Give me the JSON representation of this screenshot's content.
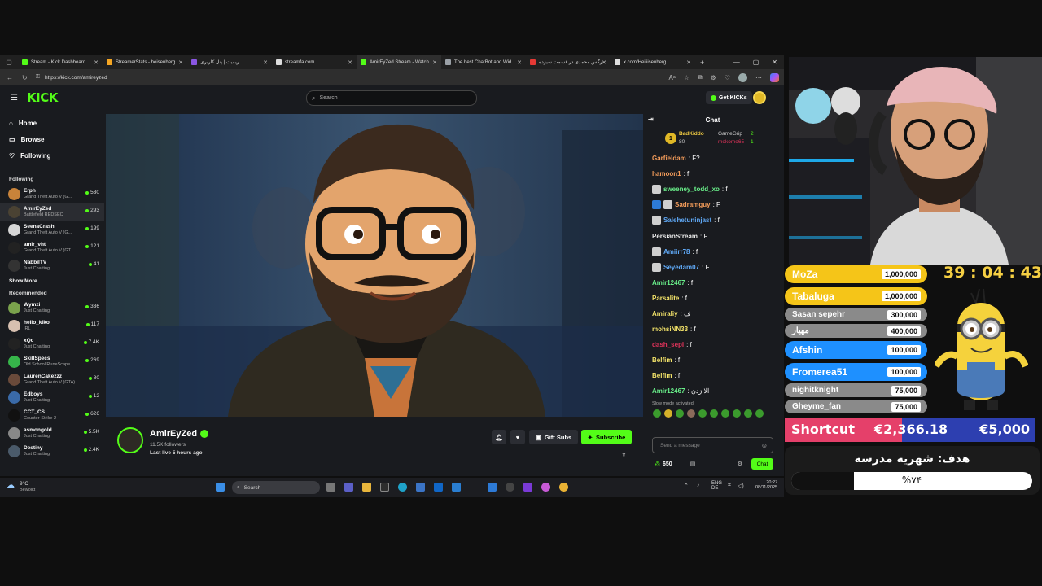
{
  "browser": {
    "tabs": [
      {
        "title": "Stream - Kick Dashboard",
        "color": "#53fc18"
      },
      {
        "title": "StreamerStats - heisenberg",
        "color": "#f5a623"
      },
      {
        "title": "ریمیت | پنل کاربری",
        "color": "#8a56e2"
      },
      {
        "title": "streamfa.com",
        "color": "#dddddd"
      },
      {
        "title": "AmirEyZed Stream - Watch",
        "color": "#53fc18"
      },
      {
        "title": "The best ChatBot and Wid...",
        "color": "#9aa0a6"
      },
      {
        "title": "نرگس محمدی در قسمت سیزده",
        "color": "#e53935"
      },
      {
        "title": "x.com/Heiiiisenberg",
        "color": "#dddddd"
      }
    ],
    "url": "https://kick.com/amireyzed"
  },
  "kick": {
    "logo": "KICK",
    "search_placeholder": "Search",
    "get_kicks": "Get KICKs",
    "nav": [
      "Home",
      "Browse",
      "Following"
    ],
    "following_header": "Following",
    "following": [
      {
        "name": "Erph",
        "game": "Grand Theft Auto V (G...",
        "viewers": "530",
        "color": "#c8833a"
      },
      {
        "name": "AmirEyZed",
        "game": "Battlefield REDSEC",
        "viewers": "293",
        "color": "#4a4233"
      },
      {
        "name": "SeenaCrash",
        "game": "Grand Theft Auto V (G...",
        "viewers": "199",
        "color": "#d6d6d6"
      },
      {
        "name": "amir_vht",
        "game": "Grand Theft Auto V (GT...",
        "viewers": "121",
        "color": "#222222"
      },
      {
        "name": "NabbilTV",
        "game": "Just Chatting",
        "viewers": "41",
        "color": "#333333"
      }
    ],
    "show_more": "Show More",
    "recommended_header": "Recommended",
    "recommended": [
      {
        "name": "Wymzi",
        "game": "Just Chatting",
        "viewers": "336",
        "color": "#7aa24c"
      },
      {
        "name": "hello_kiko",
        "game": "IRL",
        "viewers": "117",
        "color": "#d7c0b0"
      },
      {
        "name": "xQc",
        "game": "Just Chatting",
        "viewers": "7.4K",
        "color": "#222222"
      },
      {
        "name": "SkillSpecs",
        "game": "Old School RuneScape",
        "viewers": "269",
        "color": "#36b54a"
      },
      {
        "name": "LaurenCakezzz",
        "game": "Grand Theft Auto V (GTA)",
        "viewers": "80",
        "color": "#6a4a3a"
      },
      {
        "name": "Edboys",
        "game": "Just Chatting",
        "viewers": "12",
        "color": "#3a6aa8"
      },
      {
        "name": "CCT_CS",
        "game": "Counter-Strike 2",
        "viewers": "626",
        "color": "#111111"
      },
      {
        "name": "asmongold",
        "game": "Just Chatting",
        "viewers": "5.5K",
        "color": "#888888"
      },
      {
        "name": "Destiny",
        "game": "Just Chatting",
        "viewers": "2.4K",
        "color": "#4a5a6a"
      }
    ],
    "streamer": {
      "name": "AmirEyZed",
      "followers": "11.5K followers",
      "last_live": "Last live 5 hours ago",
      "gift_subs": "Gift Subs",
      "subscribe": "Subscribe"
    },
    "chat": {
      "title": "Chat",
      "pinned": [
        {
          "rank": "1",
          "name": "BadKiddo",
          "count": "80"
        },
        {
          "rank": "",
          "name": "GameGrip",
          "count": "2"
        },
        {
          "rank": "",
          "name": "mokomo65",
          "count": "1"
        }
      ],
      "messages": [
        {
          "user": "Garfieldam",
          "text": ": F?",
          "color": "#f39c5a",
          "badges": 0
        },
        {
          "user": "hamoon1",
          "text": ": f",
          "color": "#f39c5a",
          "badges": 0
        },
        {
          "user": "sweeney_todd_xo",
          "text": ": f",
          "color": "#6af28b",
          "badges": 1
        },
        {
          "user": "Sadramguy",
          "text": ": F",
          "color": "#f39c5a",
          "badges": 2
        },
        {
          "user": "Salehetuninjast",
          "text": ": f",
          "color": "#5fa8f5",
          "badges": 1
        },
        {
          "user": "PersianStream",
          "text": ": F",
          "color": "#e8e8e8",
          "badges": 0
        },
        {
          "user": "Amiirr78",
          "text": ": f",
          "color": "#5fa8f5",
          "badges": 1
        },
        {
          "user": "Seyedam07",
          "text": ": F",
          "color": "#5fa8f5",
          "badges": 1
        },
        {
          "user": "Amir12467",
          "text": ": f",
          "color": "#6af28b",
          "badges": 0
        },
        {
          "user": "Parsalite",
          "text": ": f",
          "color": "#f5e56a",
          "badges": 0
        },
        {
          "user": "Amiraliy",
          "text": ": ف",
          "color": "#f5e56a",
          "badges": 0
        },
        {
          "user": "mohsiNN33",
          "text": ": f",
          "color": "#f5e56a",
          "badges": 0
        },
        {
          "user": "dash_sepi",
          "text": ": f",
          "color": "#e0335a",
          "badges": 0
        },
        {
          "user": "Belfim",
          "text": ": f",
          "color": "#f5e56a",
          "badges": 0
        },
        {
          "user": "Belfim",
          "text": ": f",
          "color": "#f5e56a",
          "badges": 0
        },
        {
          "user": "Amir12467",
          "text": ": الا زدن",
          "color": "#6af28b",
          "badges": 0
        }
      ],
      "slow_mode": "Slow mode activated",
      "input_placeholder": "Send a message",
      "points": "650",
      "send_label": "Chat"
    }
  },
  "taskbar": {
    "weather_temp": "9°C",
    "weather_desc": "Bewölkt",
    "search": "Search",
    "lang1": "ENG",
    "lang2": "DE",
    "time": "20:27",
    "date": "08/11/2025"
  },
  "overlay": {
    "timer": "39 : 04 : 43",
    "donors": [
      {
        "name": "MoZa",
        "amount": "1,000,000",
        "color": "#f5c518"
      },
      {
        "name": "Tabaluga",
        "amount": "1,000,000",
        "color": "#f5c518"
      },
      {
        "name": "Sasan sepehr",
        "amount": "300,000",
        "color": "#8a8a8a"
      },
      {
        "name": "مهیار",
        "amount": "400,000",
        "color": "#8a8a8a"
      },
      {
        "name": "Afshin",
        "amount": "100,000",
        "color": "#1e90ff"
      },
      {
        "name": "Fromerea51",
        "amount": "100,000",
        "color": "#1e90ff"
      },
      {
        "name": "nighitknight",
        "amount": "75,000",
        "color": "#8a8a8a"
      },
      {
        "name": "Gheyme_fan",
        "amount": "75,000",
        "color": "#8a8a8a"
      }
    ],
    "goal": {
      "label": "Shortcut",
      "current": "€2,366.18",
      "target": "€5,000",
      "progress": 0.47
    },
    "school_goal": {
      "title": "هدف: شهریه مدرسه",
      "percent_text": "%۷۴",
      "progress": 0.74
    }
  }
}
